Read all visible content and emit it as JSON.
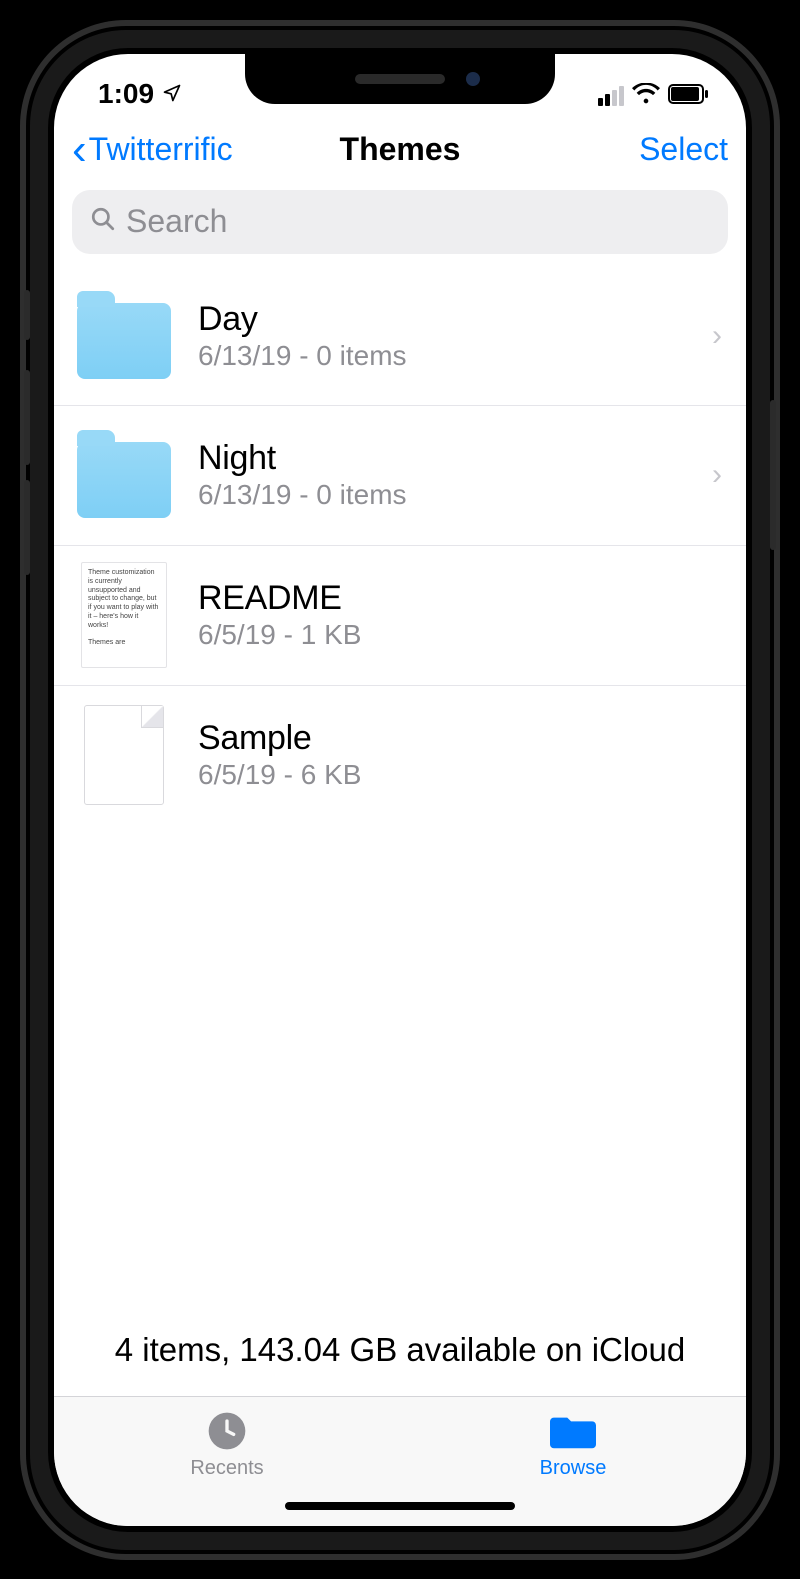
{
  "status": {
    "time": "1:09",
    "location_icon": "location-arrow"
  },
  "nav": {
    "back_label": "Twitterrific",
    "title": "Themes",
    "select_label": "Select"
  },
  "search": {
    "placeholder": "Search"
  },
  "items": [
    {
      "type": "folder",
      "title": "Day",
      "subtitle": "6/13/19 - 0 items",
      "disclosure": true
    },
    {
      "type": "folder",
      "title": "Night",
      "subtitle": "6/13/19 - 0 items",
      "disclosure": true
    },
    {
      "type": "readme",
      "title": "README",
      "subtitle": "6/5/19 - 1 KB",
      "disclosure": false,
      "preview": "Theme customization is currently unsupported and subject to change, but if you want to play with it – here's how it works!\n\nThemes are"
    },
    {
      "type": "file",
      "title": "Sample",
      "subtitle": "6/5/19 - 6 KB",
      "disclosure": false
    }
  ],
  "summary": "4 items, 143.04 GB available on iCloud",
  "tabs": {
    "recents": "Recents",
    "browse": "Browse"
  }
}
